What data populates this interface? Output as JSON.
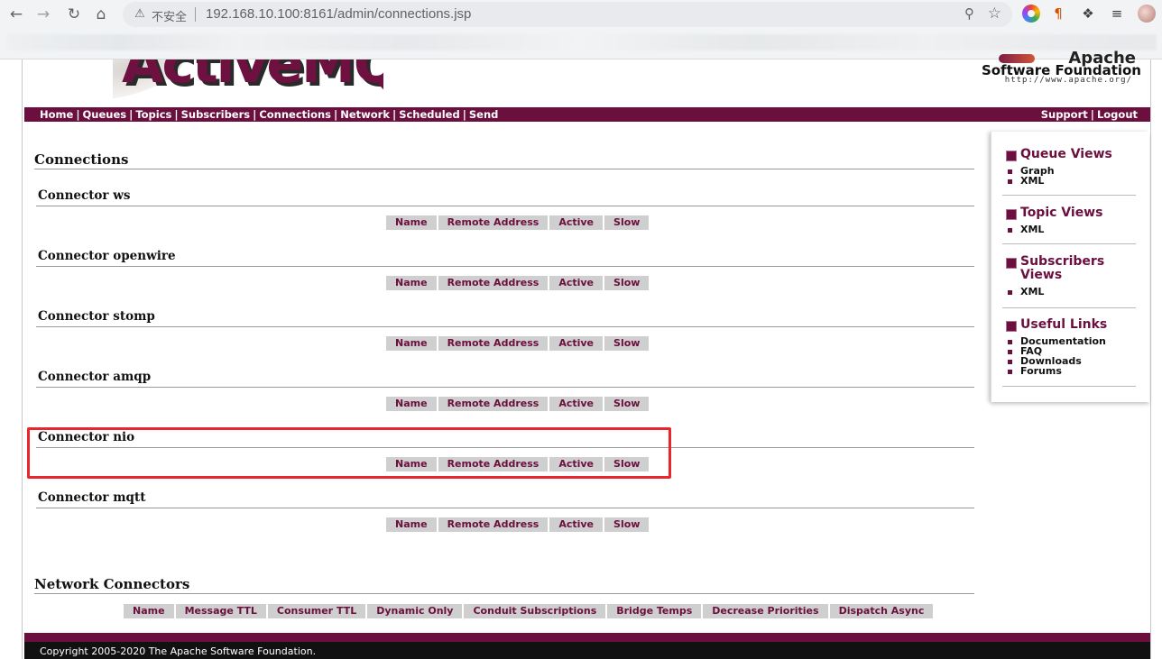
{
  "browser": {
    "insecure_label": "不安全",
    "url": "192.168.10.100:8161/admin/connections.jsp"
  },
  "header": {
    "logo_text": "ActiveMQ",
    "asf_apache": "Apache",
    "asf_name": "Software Foundation",
    "asf_url": "http://www.apache.org/"
  },
  "nav": {
    "left": [
      "Home",
      "Queues",
      "Topics",
      "Subscribers",
      "Connections",
      "Network",
      "Scheduled",
      "Send"
    ],
    "right": [
      "Support",
      "Logout"
    ]
  },
  "main": {
    "title": "Connections",
    "connector_columns": [
      "Name",
      "Remote Address",
      "Active",
      "Slow"
    ],
    "connectors": [
      {
        "label": "Connector ws"
      },
      {
        "label": "Connector openwire"
      },
      {
        "label": "Connector stomp"
      },
      {
        "label": "Connector amqp"
      },
      {
        "label": "Connector nio"
      },
      {
        "label": "Connector mqtt"
      }
    ],
    "network_title": "Network Connectors",
    "network_columns": [
      "Name",
      "Message TTL",
      "Consumer TTL",
      "Dynamic Only",
      "Conduit Subscriptions",
      "Bridge Temps",
      "Decrease Priorities",
      "Dispatch Async"
    ]
  },
  "sidebar": {
    "sections": [
      {
        "title": "Queue Views",
        "items": [
          "Graph",
          "XML"
        ]
      },
      {
        "title": "Topic Views",
        "items": [
          "XML"
        ]
      },
      {
        "title": "Subscribers Views",
        "items": [
          "XML"
        ]
      },
      {
        "title": "Useful Links",
        "items": [
          "Documentation",
          "FAQ",
          "Downloads",
          "Forums"
        ]
      }
    ]
  },
  "footer": {
    "copyright": "Copyright 2005-2020 The Apache Software Foundation."
  },
  "colors": {
    "brand": "#6b0f3e",
    "header_cell": "#cfcfcf",
    "highlight": "#e8262c"
  }
}
